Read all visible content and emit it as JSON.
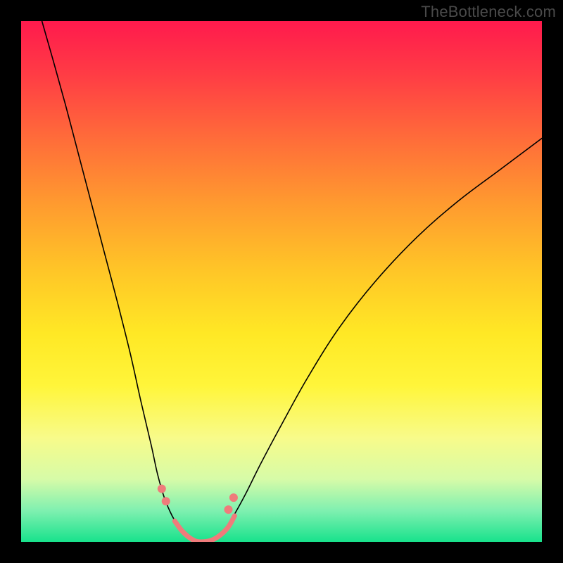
{
  "watermark": "TheBottleneck.com",
  "colors": {
    "page_bg": "#000000",
    "curve": "#000000",
    "accent": "#ef7b7b",
    "gradient_top": "#ff1a4d",
    "gradient_bottom": "#18e28c",
    "watermark_text": "#4a4a4a"
  },
  "chart_data": {
    "type": "line",
    "title": "",
    "xlabel": "",
    "ylabel": "",
    "xlim": [
      0,
      1
    ],
    "ylim": [
      0,
      1
    ],
    "grid": false,
    "legend": false,
    "series": [
      {
        "name": "curve-left",
        "x": [
          0.04,
          0.06,
          0.085,
          0.11,
          0.135,
          0.16,
          0.185,
          0.21,
          0.23,
          0.25,
          0.262,
          0.275,
          0.29,
          0.305,
          0.318
        ],
        "y": [
          1.0,
          0.93,
          0.84,
          0.745,
          0.65,
          0.555,
          0.46,
          0.36,
          0.27,
          0.185,
          0.13,
          0.085,
          0.05,
          0.025,
          0.01
        ]
      },
      {
        "name": "curve-valley",
        "x": [
          0.318,
          0.33,
          0.345,
          0.36,
          0.375,
          0.388
        ],
        "y": [
          0.01,
          0.003,
          0.0,
          0.002,
          0.008,
          0.02
        ]
      },
      {
        "name": "curve-right",
        "x": [
          0.388,
          0.405,
          0.43,
          0.46,
          0.5,
          0.55,
          0.61,
          0.68,
          0.76,
          0.84,
          0.92,
          1.0
        ],
        "y": [
          0.02,
          0.045,
          0.09,
          0.15,
          0.225,
          0.315,
          0.41,
          0.5,
          0.585,
          0.655,
          0.715,
          0.775
        ]
      },
      {
        "name": "accent-line",
        "x": [
          0.295,
          0.31,
          0.328,
          0.345,
          0.37,
          0.395,
          0.41
        ],
        "y": [
          0.04,
          0.02,
          0.005,
          0.0,
          0.005,
          0.025,
          0.05
        ]
      }
    ],
    "accent_markers": [
      {
        "name": "dot-left-upper",
        "x": 0.27,
        "y": 0.102
      },
      {
        "name": "dot-left-lower",
        "x": 0.278,
        "y": 0.078
      },
      {
        "name": "dot-right-lower",
        "x": 0.398,
        "y": 0.062
      },
      {
        "name": "dot-right-upper",
        "x": 0.408,
        "y": 0.085
      }
    ]
  }
}
